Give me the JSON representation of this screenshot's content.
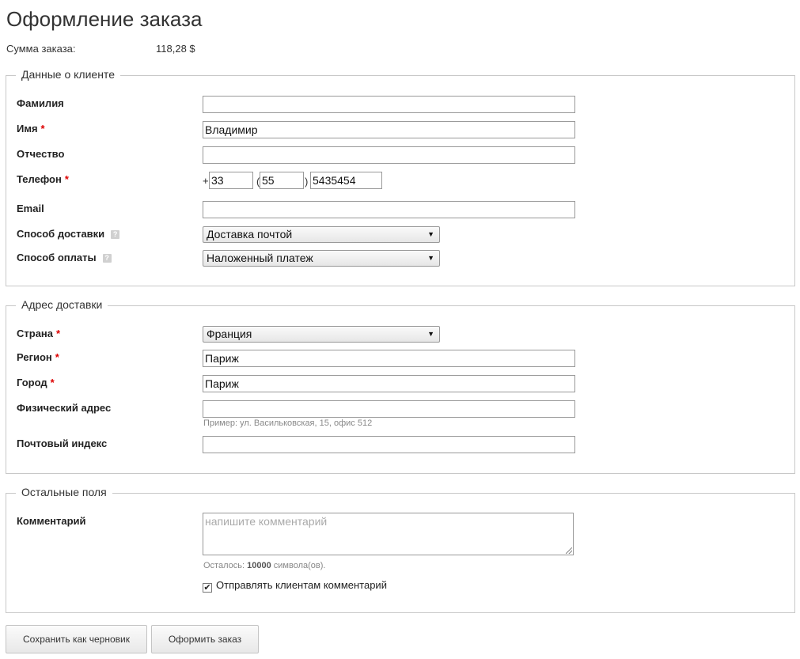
{
  "page_title": "Оформление заказа",
  "order_sum": {
    "label": "Сумма заказа:",
    "value": "118,28 $"
  },
  "customer": {
    "legend": "Данные о клиенте",
    "last_name_label": "Фамилия",
    "last_name_value": "",
    "first_name_label": "Имя",
    "first_name_value": "Владимир",
    "middle_name_label": "Отчество",
    "middle_name_value": "",
    "phone_label": "Телефон",
    "phone_plus": "+",
    "phone_country": "33",
    "phone_open": "(",
    "phone_code": "55",
    "phone_close": ")",
    "phone_number": "5435454",
    "email_label": "Email",
    "email_value": "",
    "delivery_label": "Способ доставки",
    "delivery_value": "Доставка почтой",
    "payment_label": "Способ оплаты",
    "payment_value": "Наложенный платеж",
    "required_mark": "*",
    "help_mark": "?"
  },
  "address": {
    "legend": "Адрес доставки",
    "country_label": "Страна",
    "country_value": "Франция",
    "region_label": "Регион",
    "region_value": "Париж",
    "city_label": "Город",
    "city_value": "Париж",
    "street_label": "Физический адрес",
    "street_value": "",
    "street_hint": "Пример: ул. Васильковская, 15, офис 512",
    "zip_label": "Почтовый индекс",
    "zip_value": ""
  },
  "other": {
    "legend": "Остальные поля",
    "comment_label": "Комментарий",
    "comment_placeholder": "напишите комментарий",
    "remaining_prefix": "Осталось:",
    "remaining_count": "10000",
    "remaining_suffix": "символа(ов).",
    "send_comment_label": "Отправлять клиентам комментарий",
    "send_comment_checked": true
  },
  "buttons": {
    "save_draft": "Сохранить как черновик",
    "submit": "Оформить заказ"
  },
  "icons": {
    "select_arrow": "▼",
    "checkmark": "✔"
  },
  "colors": {
    "required": "#dd0000",
    "border": "#c8c8c8"
  }
}
